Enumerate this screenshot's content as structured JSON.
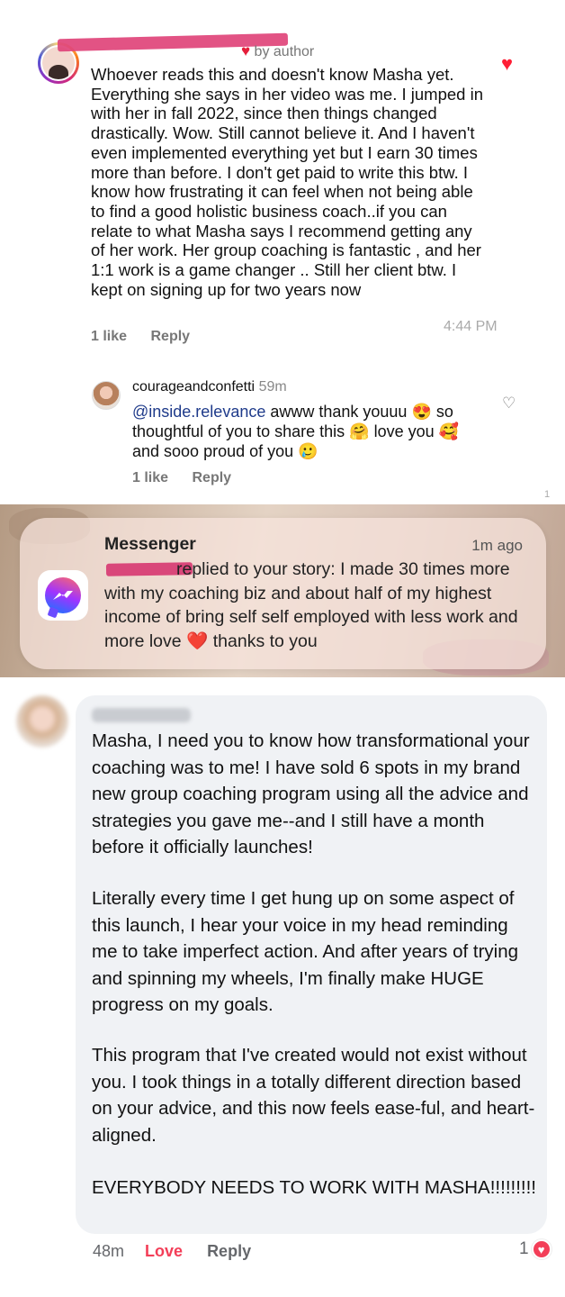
{
  "ig_comment": {
    "meta_badge": "by author",
    "body": "Whoever reads this and doesn't know Masha yet. Everything she says in her video was me. I jumped in with her in fall 2022, since then things changed drastically. Wow. Still cannot believe it. And I haven't even implemented everything yet but I earn 30 times more than before. I don't get paid to write this btw. I know how frustrating it can feel when not being able to find a good holistic business coach..if you can relate to what Masha says I recommend getting any of her work. Her group coaching is fantastic , and her 1:1 work is a game changer .. Still her client btw. I kept on signing up for two years now",
    "time": "4:44 PM",
    "likes": "1 like",
    "reply_label": "Reply",
    "reply": {
      "username": "courageandconfetti",
      "ago": "59m",
      "mention": "@inside.relevance",
      "text_1": " awww thank youuu 😍 so thoughtful of you to share this 🤗 love you 🥰 and sooo proud of you 🥲",
      "likes": "1 like",
      "reply_label": "Reply"
    },
    "tiny_num": "1"
  },
  "messenger": {
    "app_name": "Messenger",
    "ago": "1m ago",
    "text": "replied to your story: I made 30 times more with my coaching biz and about half of my highest income of bring self self employed with less work and more love",
    "heart": "❤️",
    "text_end": " thanks to you"
  },
  "fb_comment": {
    "paragraph_1": "Masha, I need you to know how transformational your coaching was to me! I have sold 6 spots in my brand new group coaching program using all the advice and strategies you gave me--and I still have a month before it officially launches!",
    "paragraph_2": "Literally every time I get hung up on some aspect of this launch, I hear your voice in my head reminding me to take imperfect action. And after years of trying and spinning my wheels, I'm finally make HUGE progress on my goals.",
    "paragraph_3": "This program that I've created would not exist without you. I took things in a totally different direction based on your advice, and this now feels ease-ful, and heart-aligned.",
    "paragraph_4": "EVERYBODY NEEDS TO WORK WITH MASHA!!!!!!!!!",
    "ago": "48m",
    "love_label": "Love",
    "reply_label": "Reply",
    "reaction_count": "1"
  },
  "colors": {
    "ig_like": "#ff1e35",
    "fb_love": "#f33e58",
    "fb_bubble": "#f0f2f5"
  }
}
